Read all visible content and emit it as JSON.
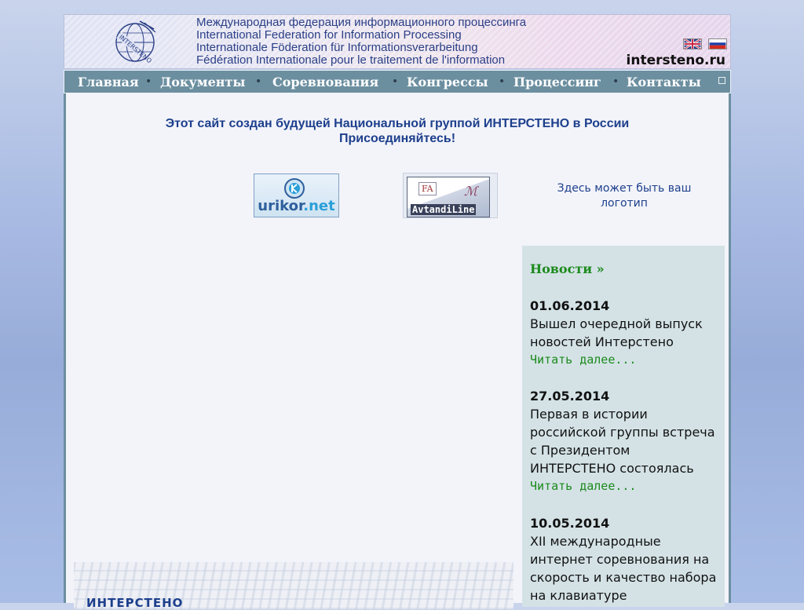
{
  "header": {
    "lines": [
      "Международная федерация информационного процессинга",
      "International Federation for Information Processing",
      "Internationale Föderation für Informationsverarbeitung",
      "Fédération Internationale pour le traitement de l'information"
    ],
    "logo_text": "INTERSTENO",
    "domain": "intersteno.ru",
    "languages": [
      {
        "icon": "uk-flag-icon",
        "name": "English"
      },
      {
        "icon": "russia-flag-icon",
        "name": "Русский"
      }
    ]
  },
  "nav": {
    "items": [
      "Главная",
      "Документы",
      "Соревнования",
      "Конгрессы",
      "Процессинг",
      "Контакты"
    ],
    "separator": "•"
  },
  "intro": {
    "line1": "Этот сайт создан будущей Национальной группой ИНТЕРСТЕНО в России",
    "line2": "Присоединяйтесь!"
  },
  "partners": {
    "urikor_main": "urikor",
    "urikor_suffix": ".net",
    "avtandi": "AvtandiLine",
    "avtandi_mark": "FA",
    "placeholder": "Здесь может быть ваш логотип"
  },
  "news": {
    "heading": "Новости »",
    "items": [
      {
        "date": "01.06.2014",
        "text": "Вышел очередной выпуск новостей Интерстено",
        "more": "Читать далее..."
      },
      {
        "date": "27.05.2014",
        "text": "Первая в истории российской группы встреча с Президентом ИНТЕРСТЕНО состоялась",
        "more": "Читать далее..."
      },
      {
        "date": "10.05.2014",
        "text": "XII международные интернет соревнования на скорость и качество набора на клавиатуре",
        "more": ""
      }
    ]
  },
  "footer_strip": {
    "title": "ИНТЕРСТЕНО"
  },
  "colors": {
    "nav_bg": "#6c8fa0",
    "link_green": "#1c8a1c",
    "heading_blue": "#1d3f8c",
    "news_bg": "#d4e2e6"
  }
}
